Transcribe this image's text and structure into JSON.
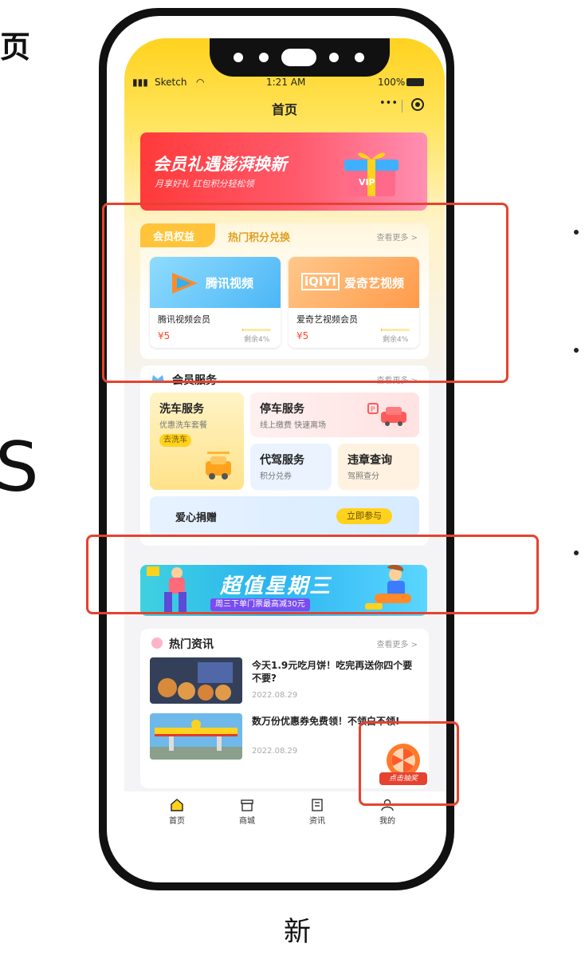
{
  "side": {
    "top_char": "页",
    "mid_char": "S",
    "caption": "新"
  },
  "status_bar": {
    "signal": "Sketch",
    "time": "1:21 AM",
    "battery": "100%"
  },
  "nav": {
    "title": "首页",
    "more": "•••"
  },
  "banner_top": {
    "title": "会员礼遇澎湃换新",
    "subtitle": "月享好礼 红包积分轻松领",
    "badge": "VIP"
  },
  "benefits": {
    "tab_active": "会员权益",
    "tab_inactive": "热门积分兑换",
    "more": "查看更多 >",
    "items": [
      {
        "logo": "腾讯视频",
        "name": "腾讯视频会员",
        "price": "¥5",
        "remain": "剩余4%",
        "remain_fraction": 0.04
      },
      {
        "logo": "爱奇艺视频",
        "logo_mark": "iQIYI",
        "name": "爱奇艺视频会员",
        "price": "¥5",
        "remain": "剩余4%",
        "remain_fraction": 0.04
      }
    ]
  },
  "services": {
    "title": "会员服务",
    "more": "查看更多 >",
    "wash": {
      "title": "洗车服务",
      "desc": "优惠洗车套餐",
      "button": "去洗车"
    },
    "parking": {
      "title": "停车服务",
      "desc": "线上缴费 快速离场"
    },
    "driver": {
      "title": "代驾服务",
      "desc": "积分兑券"
    },
    "violation": {
      "title": "违章查询",
      "desc": "驾照查分"
    },
    "charity": {
      "title": "爱心捐赠",
      "button": "立即参与"
    }
  },
  "banner_mid": {
    "title": "超值星期三",
    "subtitle": "周三下单门票最高减30元"
  },
  "news": {
    "title": "热门资讯",
    "more": "查看更多 >",
    "items": [
      {
        "title": "今天1.9元吃月饼！吃完再送你四个要不要?",
        "date": "2022.08.29"
      },
      {
        "title": "数万份优惠券免费领！不领白不领!",
        "date": "2022.08.29"
      }
    ]
  },
  "lottery": {
    "label": "点击抽奖"
  },
  "tabbar": [
    {
      "label": "首页",
      "icon": "home-icon"
    },
    {
      "label": "商城",
      "icon": "store-icon"
    },
    {
      "label": "资讯",
      "icon": "news-icon"
    },
    {
      "label": "我的",
      "icon": "user-icon"
    }
  ],
  "colors": {
    "accent": "#ffd21e",
    "highlight_box": "#e5432f",
    "tencent_blue": "#2fb0ef",
    "iqiyi_orange": "#ff9a4a"
  }
}
